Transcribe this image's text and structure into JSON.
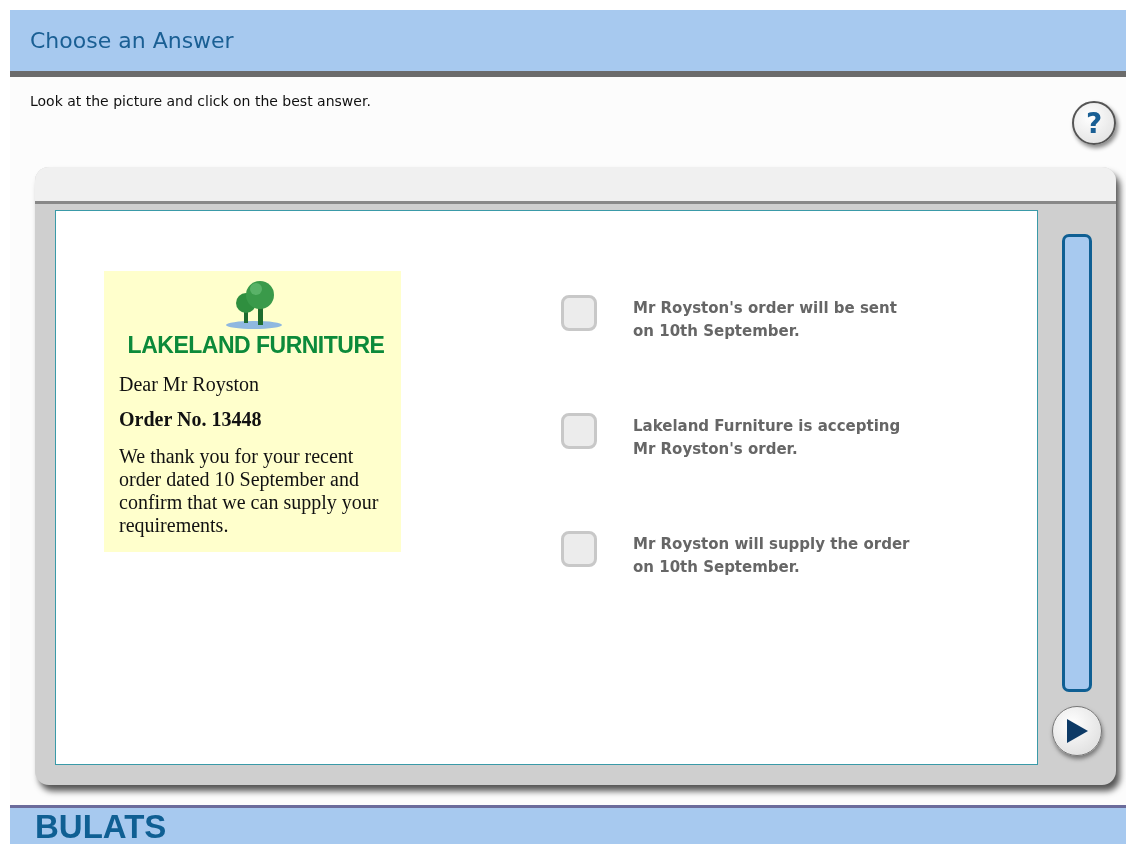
{
  "header": {
    "title": "Choose an Answer"
  },
  "instruction": "Look at the picture and click on the best answer.",
  "help_button": {
    "label": "?"
  },
  "letter": {
    "company": "LAKELAND FURNITURE",
    "greeting": "Dear Mr Royston",
    "order": "Order No. 13448",
    "body": "We thank you for your recent order dated 10 September and confirm that we can supply your requirements."
  },
  "options": [
    {
      "text": "Mr Royston's order will be sent on 10th September.",
      "selected": false
    },
    {
      "text": "Lakeland Furniture is accepting Mr Royston's order.",
      "selected": false
    },
    {
      "text": "Mr Royston will supply the order on 10th September.",
      "selected": false
    }
  ],
  "footer": {
    "brand": "BULATS"
  }
}
